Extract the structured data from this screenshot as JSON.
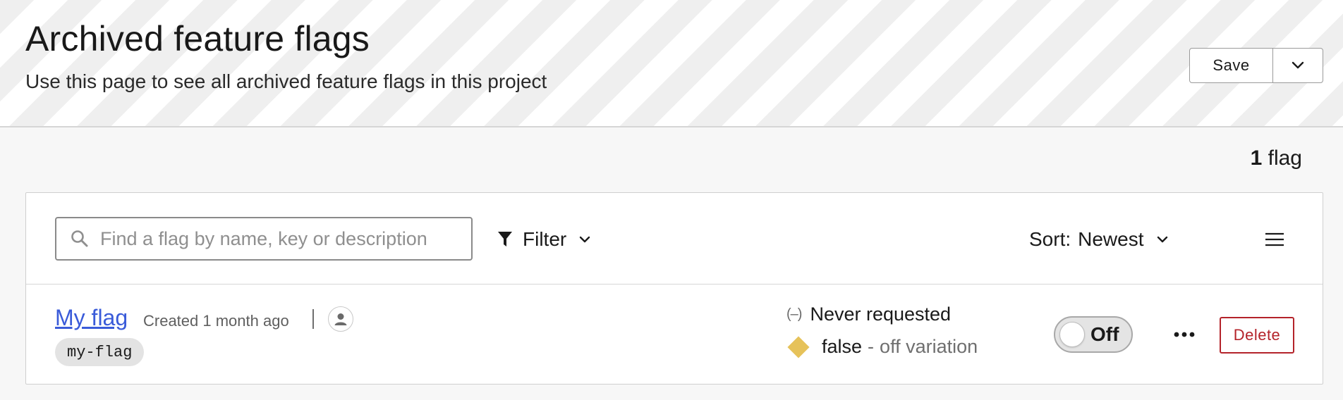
{
  "header": {
    "title": "Archived feature flags",
    "subtitle": "Use this page to see all archived feature flags in this project",
    "save_label": "Save"
  },
  "summary": {
    "count": "1",
    "unit": "flag"
  },
  "toolbar": {
    "search_placeholder": "Find a flag by name, key or description",
    "search_value": "",
    "filter_label": "Filter",
    "sort_prefix": "Sort:",
    "sort_value": "Newest"
  },
  "flags": [
    {
      "name": "My flag",
      "created": "Created 1 month ago",
      "key": "my-flag",
      "evaluation_symbol": "(–)",
      "evaluation_status": "Never requested",
      "variation_value": "false",
      "variation_separator": "-",
      "variation_name": "off variation",
      "variation_color": "#e6c25a",
      "toggle_label": "Off",
      "toggle_on": false,
      "delete_label": "Delete"
    }
  ],
  "colors": {
    "link": "#3a5bd9",
    "danger": "#b4232a",
    "variation_false": "#e6c25a"
  }
}
